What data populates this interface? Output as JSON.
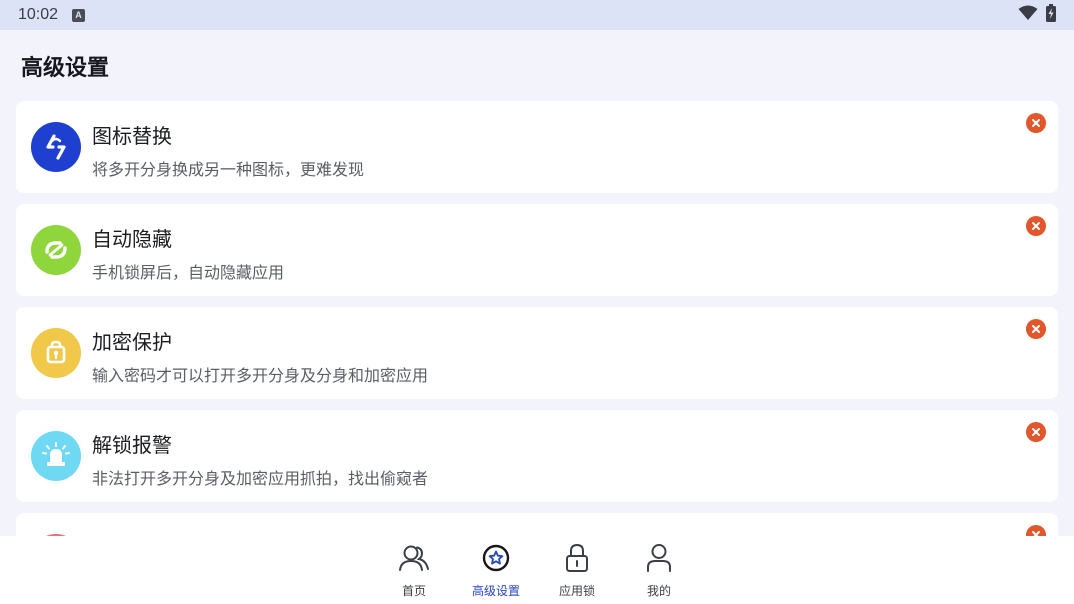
{
  "status_bar": {
    "time": "10:02",
    "notification_icon": "keyboard-notification-icon",
    "wifi_icon": "wifi-icon",
    "battery_icon": "battery-charging-icon"
  },
  "page": {
    "title": "高级设置"
  },
  "features": [
    {
      "title": "图标替换",
      "description": "将多开分身换成另一种图标，更难发现",
      "icon": "icon-swap-icon",
      "icon_color": "#1f3fd1"
    },
    {
      "title": "自动隐藏",
      "description": "手机锁屏后，自动隐藏应用",
      "icon": "auto-hide-icon",
      "icon_color": "#8ed63c"
    },
    {
      "title": "加密保护",
      "description": "输入密码才可以打开多开分身及分身和加密应用",
      "icon": "lock-shield-icon",
      "icon_color": "#f2c84b"
    },
    {
      "title": "解锁报警",
      "description": "非法打开多开分身及加密应用抓拍，找出偷窥者",
      "icon": "alarm-siren-icon",
      "icon_color": "#6fd8f2"
    }
  ],
  "close_icon_color": "#e2562b",
  "bottom_nav": {
    "items": [
      {
        "label": "首页",
        "icon": "users-icon",
        "active": false
      },
      {
        "label": "高级设置",
        "icon": "star-circle-icon",
        "active": true
      },
      {
        "label": "应用锁",
        "icon": "padlock-icon",
        "active": false
      },
      {
        "label": "我的",
        "icon": "person-icon",
        "active": false
      }
    ],
    "active_color": "#2545c9"
  }
}
